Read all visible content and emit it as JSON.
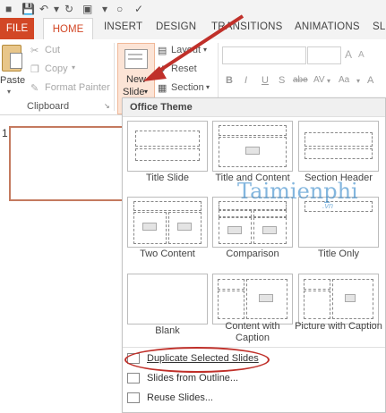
{
  "ribbon_tabs": {
    "file": "FILE",
    "home": "HOME",
    "insert": "INSERT",
    "design": "DESIGN",
    "transitions": "TRANSITIONS",
    "animations": "ANIMATIONS",
    "sl": "SL"
  },
  "clipboard": {
    "paste": "Paste",
    "cut": "Cut",
    "copy": "Copy",
    "format_painter": "Format Painter",
    "group_label": "Clipboard"
  },
  "slides": {
    "new_slide_line1": "New",
    "new_slide_line2": "Slide",
    "layout": "Layout",
    "reset": "Reset",
    "section": "Section"
  },
  "font_buttons": {
    "bold": "B",
    "italic": "I",
    "underline": "U",
    "strike": "S",
    "shadow": "abe",
    "spacing": "AV"
  },
  "thumbnail": {
    "slide_number": "1"
  },
  "menu": {
    "header": "Office Theme",
    "layouts": [
      {
        "label": "Title Slide"
      },
      {
        "label": "Title and Content"
      },
      {
        "label": "Section Header"
      },
      {
        "label": "Two Content"
      },
      {
        "label": "Comparison"
      },
      {
        "label": "Title Only"
      },
      {
        "label": "Blank"
      },
      {
        "label": "Content with Caption"
      },
      {
        "label": "Picture with Caption"
      }
    ],
    "items": [
      {
        "label": "Duplicate Selected Slides"
      },
      {
        "label": "Slides from Outline..."
      },
      {
        "label": "Reuse Slides..."
      }
    ]
  },
  "watermark": {
    "brand": "Taimienphi",
    "domain": ".vn"
  },
  "colors": {
    "accent": "#d24726",
    "annotation": "#c0302a",
    "watermark": "#1e7bc4"
  }
}
